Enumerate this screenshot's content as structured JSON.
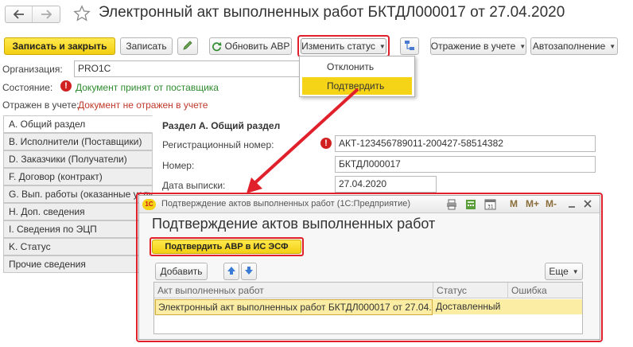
{
  "window": {
    "title": "Электронный акт выполненных работ БКТДЛ000017 от 27.04.2020",
    "back_icon": "arrow-left-icon",
    "forward_icon": "arrow-right-icon",
    "favorite_icon": "star-icon"
  },
  "toolbar": {
    "save_close": "Записать и закрыть",
    "save": "Записать",
    "edit_icon": "pencil-icon",
    "refresh_icon": "refresh-icon",
    "refresh_avr": "Обновить АВР",
    "change_status": "Изменить статус",
    "structure_icon": "structure-icon",
    "reflection": "Отражение в учете",
    "autofill": "Автозаполнение"
  },
  "status_menu": {
    "items": [
      "Отклонить",
      "Подтвердить"
    ]
  },
  "header": {
    "org_label": "Организация:",
    "org_value": "PRO1C",
    "state_label": "Состояние:",
    "state_value": "Документ принят от поставщика",
    "reflect_label": "Отражен в учете:",
    "reflect_value": "Документ не отражен в учете"
  },
  "tabs": [
    "А. Общий раздел",
    "B. Исполнители (Поставщики)",
    "D. Заказчики (Получатели)",
    "F. Договор (контракт)",
    "G. Вып. работы (оказанные услуги)",
    "H. Доп. сведения",
    "I. Сведения по ЭЦП",
    "K. Статус",
    "Прочие сведения"
  ],
  "section": {
    "title": "Раздел А. Общий раздел",
    "reg_label": "Регистрационный номер:",
    "reg_value": "АКТ-123456789011-200427-58514382",
    "num_label": "Номер:",
    "num_value": "БКТДЛ000017",
    "date_label": "Дата выписки:",
    "date_value": "27.04.2020"
  },
  "dialog": {
    "title_bar": "Подтверждение актов выполненных работ  (1С:Предприятие)",
    "logo": "1С",
    "heading": "Подтверждение актов выполненных работ",
    "confirm_button": "Подтвердить АВР в ИС ЭСФ",
    "add_button": "Добавить",
    "more_button": "Еще",
    "title_icons": [
      "printer-icon",
      "calculator-icon",
      "calendar-icon"
    ],
    "memory_buttons": [
      "M",
      "M+",
      "M-"
    ],
    "columns": [
      "Акт выполненных работ",
      "Статус",
      "Ошибка"
    ],
    "rows": [
      [
        "Электронный акт выполненных работ БКТДЛ000017 от 27.04.2020",
        "Доставленный",
        ""
      ]
    ]
  },
  "colors": {
    "highlight_red": "#e0202a",
    "accent_yellow": "#f5d316",
    "state_green": "#2e8b2e",
    "reflect_red": "#c0392b"
  }
}
